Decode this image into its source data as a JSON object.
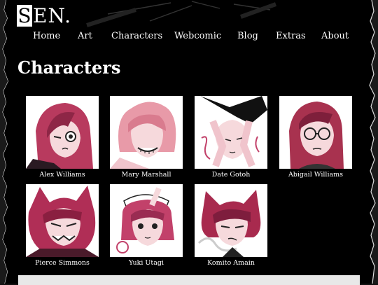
{
  "site": {
    "logo_initial": "S",
    "logo_rest": "EN."
  },
  "nav": {
    "items": [
      {
        "id": "home",
        "label": "Home"
      },
      {
        "id": "art",
        "label": "Art"
      },
      {
        "id": "characters",
        "label": "Characters"
      },
      {
        "id": "webcomic",
        "label": "Webcomic"
      },
      {
        "id": "blog",
        "label": "Blog"
      },
      {
        "id": "extras",
        "label": "Extras"
      },
      {
        "id": "about",
        "label": "About"
      }
    ]
  },
  "page": {
    "title": "Characters"
  },
  "characters": [
    {
      "name": "Alex Williams",
      "hair": "#b83a5e"
    },
    {
      "name": "Mary Marshall",
      "hair": "#e89aa8"
    },
    {
      "name": "Date Gotoh",
      "hair": "#111111"
    },
    {
      "name": "Abigail Williams",
      "hair": "#a8324f"
    },
    {
      "name": "Pierce Simmons",
      "hair": "#b02e56"
    },
    {
      "name": "Yuki Utagi",
      "hair": "#c2416a"
    },
    {
      "name": "Komito Amain",
      "hair": "#a82a4e"
    }
  ],
  "colors": {
    "background": "#000000",
    "text": "#ffffff",
    "accent": "#c2416a",
    "skin": "#f6d9dc"
  }
}
